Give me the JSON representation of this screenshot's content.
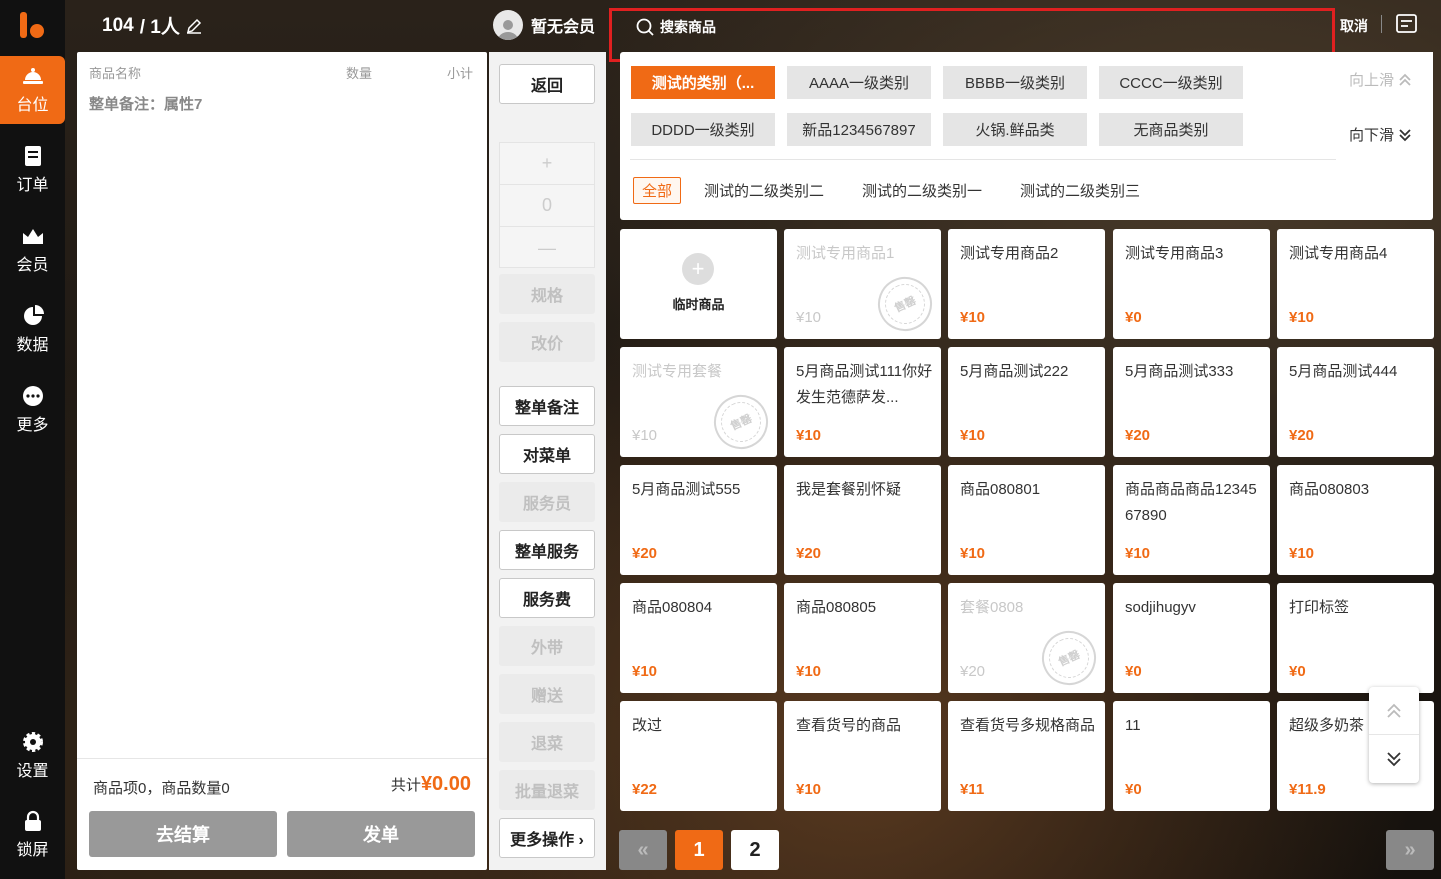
{
  "sidebar": {
    "items": [
      {
        "label": "台位",
        "icon": "table-icon"
      },
      {
        "label": "订单",
        "icon": "order-icon"
      },
      {
        "label": "会员",
        "icon": "member-icon"
      },
      {
        "label": "数据",
        "icon": "pie-chart-icon"
      },
      {
        "label": "更多",
        "icon": "more-icon"
      }
    ],
    "bottom": [
      {
        "label": "设置",
        "icon": "gear-icon"
      },
      {
        "label": "锁屏",
        "icon": "lock-icon"
      }
    ]
  },
  "header": {
    "table_no": "104",
    "people": "/ 1人",
    "member": "暂无会员",
    "search_placeholder": "搜索商品",
    "cancel": "取消"
  },
  "order": {
    "col_name": "商品名称",
    "col_qty": "数量",
    "col_subtotal": "小计",
    "remark": "整单备注：属性7",
    "summary": "商品项0，商品数量0",
    "total_label": "共计",
    "total_value": "¥0.00",
    "checkout": "去结算",
    "send": "发单"
  },
  "actions": {
    "back": "返回",
    "stepper_plus": "+",
    "stepper_value": "0",
    "stepper_minus": "—",
    "spec": "规格",
    "reprice": "改价",
    "whole_remark": "整单备注",
    "check_menu": "对菜单",
    "waiter": "服务员",
    "whole_service": "整单服务",
    "service_fee": "服务费",
    "takeout": "外带",
    "gift": "赠送",
    "return_dish": "退菜",
    "batch_return": "批量退菜",
    "more": "更多操作 ›"
  },
  "categories": {
    "row1": [
      "测试的类别（...",
      "AAAA一级类别",
      "BBBB一级类别",
      "CCCC一级类别"
    ],
    "row2": [
      "DDDD一级类别",
      "新品1234567897",
      "火锅.鲜品类",
      "无商品类别"
    ],
    "sub": [
      "全部",
      "测试的二级类别二",
      "测试的二级类别一",
      "测试的二级类别三"
    ],
    "scroll_up": "向上滑",
    "scroll_down": "向下滑"
  },
  "products": [
    {
      "name": "临时商品",
      "price": ""
    },
    {
      "name": "测试专用商品1",
      "price": "¥10",
      "stamp": "售罄"
    },
    {
      "name": "测试专用商品2",
      "price": "¥10"
    },
    {
      "name": "测试专用商品3",
      "price": "¥0"
    },
    {
      "name": "测试专用商品4",
      "price": "¥10"
    },
    {
      "name": "测试专用套餐",
      "price": "¥10",
      "stamp": "售罄"
    },
    {
      "name": "5月商品测试111你好发生范德萨发...",
      "price": "¥10"
    },
    {
      "name": "5月商品测试222",
      "price": "¥10"
    },
    {
      "name": "5月商品测试333",
      "price": "¥20"
    },
    {
      "name": "5月商品测试444",
      "price": "¥20"
    },
    {
      "name": "5月商品测试555",
      "price": "¥20"
    },
    {
      "name": "我是套餐别怀疑",
      "price": "¥20"
    },
    {
      "name": "商品080801",
      "price": "¥10"
    },
    {
      "name": "商品商品商品1234567890",
      "price": "¥10"
    },
    {
      "name": "商品080803",
      "price": "¥10"
    },
    {
      "name": "商品080804",
      "price": "¥10"
    },
    {
      "name": "商品080805",
      "price": "¥10"
    },
    {
      "name": "套餐0808",
      "price": "¥20",
      "stamp": "售罄"
    },
    {
      "name": "sodjihugyv",
      "price": "¥0"
    },
    {
      "name": "打印标签",
      "price": "¥0"
    },
    {
      "name": "改过",
      "price": "¥22"
    },
    {
      "name": "查看货号的商品",
      "price": "¥10"
    },
    {
      "name": "查看货号多规格商品",
      "price": "¥11"
    },
    {
      "name": "11",
      "price": "¥0"
    },
    {
      "name": "超级多奶茶",
      "price": "¥11.9"
    }
  ],
  "pagination": {
    "prev": "«",
    "pages": [
      "1",
      "2"
    ],
    "next": "»"
  },
  "colors": {
    "accent": "#f06a15",
    "sidebar": "#111111",
    "highlight": "#e02020"
  }
}
